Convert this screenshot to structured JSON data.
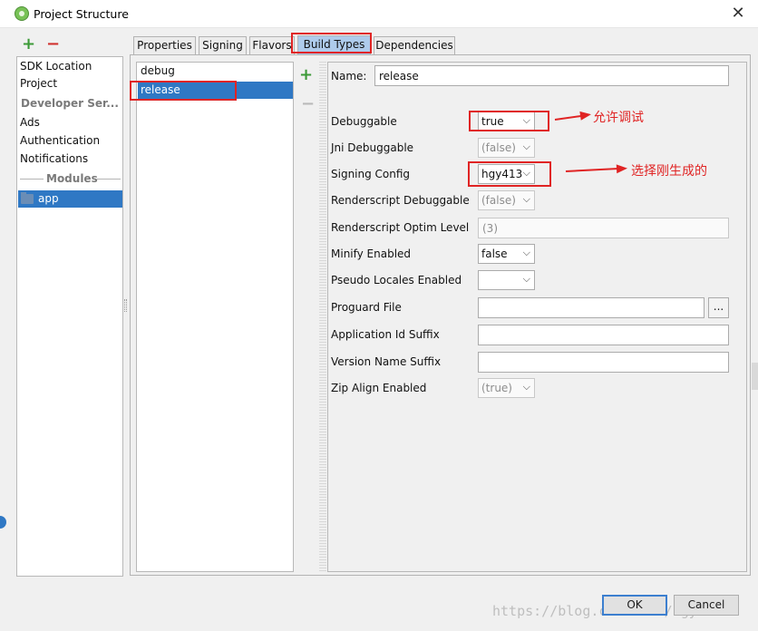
{
  "window": {
    "title": "Project Structure",
    "close_glyph": "✕",
    "icon": "android-studio-icon"
  },
  "sidebar": {
    "add_glyph": "+",
    "remove_glyph": "−",
    "items": [
      {
        "label": "SDK Location"
      },
      {
        "label": "Project"
      },
      {
        "label": "Developer Ser..."
      },
      {
        "label": "Ads"
      },
      {
        "label": "Authentication"
      },
      {
        "label": "Notifications"
      },
      {
        "label": "Modules"
      },
      {
        "label": "app",
        "selected": true
      }
    ]
  },
  "tabs": [
    {
      "label": "Properties"
    },
    {
      "label": "Signing"
    },
    {
      "label": "Flavors"
    },
    {
      "label": "Build Types",
      "active": true
    },
    {
      "label": "Dependencies"
    }
  ],
  "build_types": {
    "items": [
      "debug",
      "release"
    ],
    "selected": "release",
    "add_glyph": "+",
    "remove_glyph": "−"
  },
  "form": {
    "name": {
      "label": "Name:",
      "value": "release"
    },
    "debuggable": {
      "label": "Debuggable",
      "value": "true"
    },
    "jni_debuggable": {
      "label": "Jni Debuggable",
      "value": "(false)"
    },
    "signing_config": {
      "label": "Signing Config",
      "value": "hgy413"
    },
    "renderscript_debuggable": {
      "label": "Renderscript Debuggable",
      "value": "(false)"
    },
    "renderscript_optim_level": {
      "label": "Renderscript Optim Level",
      "value": "(3)"
    },
    "minify_enabled": {
      "label": "Minify Enabled",
      "value": "false"
    },
    "pseudo_locales_enabled": {
      "label": "Pseudo Locales Enabled",
      "value": ""
    },
    "proguard_file": {
      "label": "Proguard File",
      "value": "",
      "browse_label": "..."
    },
    "application_id_suffix": {
      "label": "Application Id Suffix",
      "value": ""
    },
    "version_name_suffix": {
      "label": "Version Name Suffix",
      "value": ""
    },
    "zip_align_enabled": {
      "label": "Zip Align Enabled",
      "value": "(true)"
    },
    "chevron_glyph": "⌵"
  },
  "annotations": {
    "allow_debug": "允许调试",
    "select_generated": "选择刚生成的",
    "color": "#e02424"
  },
  "footer": {
    "ok_label": "OK",
    "cancel_label": "Cancel"
  },
  "watermark": "https://blog.csdn.net/hgy413"
}
